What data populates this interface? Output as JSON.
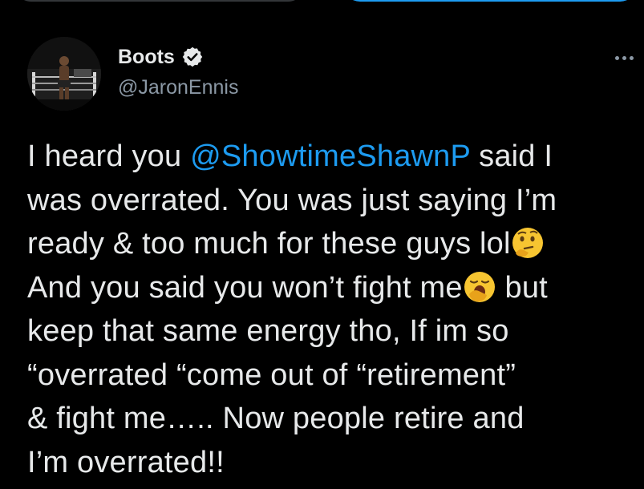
{
  "author": {
    "display_name": "Boots",
    "handle": "@JaronEnnis",
    "verified": true,
    "avatar_icon": "boxer-in-ring-avatar"
  },
  "menu_icon": "more-options-icon",
  "tweet": {
    "line1_pre": "I heard you ",
    "mention": "@ShowtimeShawnP",
    "line1_post": " said I",
    "line2": "was overrated. You was just saying I’m",
    "line3": "ready & too much for these guys lol",
    "emoji1": "thinking-face-emoji",
    "line4_pre": "And you said you won’t fight me",
    "emoji2": "yawning-face-emoji",
    "line4_post": " but",
    "line5": "keep that same energy tho, If im so",
    "line6": "“overrated “come out of “retirement”",
    "line7": "& fight me….. Now people retire and",
    "line8": "I’m overrated!!"
  },
  "colors": {
    "background": "#000000",
    "text": "#e7e9ea",
    "secondary_text": "#8b98a5",
    "accent": "#1d9bf0"
  }
}
